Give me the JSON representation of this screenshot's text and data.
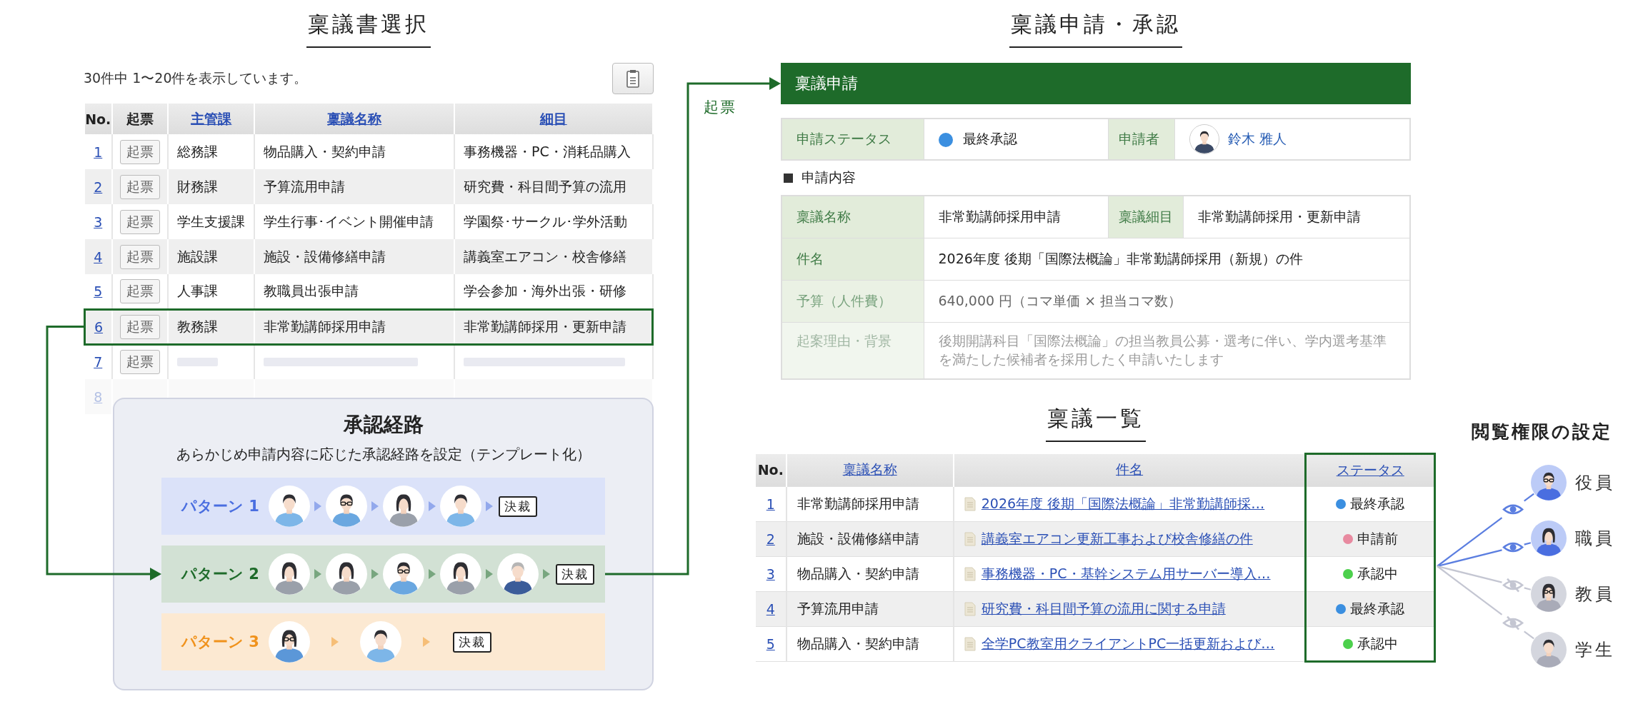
{
  "selection": {
    "title": "稟議書選択",
    "count_text": "30件中 1〜20件を表示しています。",
    "columns": [
      {
        "label": "No.",
        "kind": "plain"
      },
      {
        "label": "起票",
        "kind": "plain"
      },
      {
        "label": "主管課",
        "kind": "link"
      },
      {
        "label": "稟議名称",
        "kind": "link"
      },
      {
        "label": "細目",
        "kind": "link"
      }
    ],
    "rows": [
      {
        "kind": "data",
        "no": "1",
        "button": "起票",
        "dept": "総務課",
        "name": "物品購入・契約申請",
        "detail": "事務機器・PC・消耗品購入",
        "selected": false
      },
      {
        "kind": "data",
        "no": "2",
        "button": "起票",
        "dept": "財務課",
        "name": "予算流用申請",
        "detail": "研究費・科目間予算の流用",
        "selected": false
      },
      {
        "kind": "data",
        "no": "3",
        "button": "起票",
        "dept": "学生支援課",
        "name": "学生行事･イベント開催申請",
        "detail": "学園祭･サークル･学外活動",
        "selected": false
      },
      {
        "kind": "data",
        "no": "4",
        "button": "起票",
        "dept": "施設課",
        "name": "施設・設備修繕申請",
        "detail": "講義室エアコン・校舎修繕",
        "selected": false
      },
      {
        "kind": "data",
        "no": "5",
        "button": "起票",
        "dept": "人事課",
        "name": "教職員出張申請",
        "detail": "学会参加・海外出張・研修",
        "selected": false
      },
      {
        "kind": "data",
        "no": "6",
        "button": "起票",
        "dept": "教務課",
        "name": "非常勤講師採用申請",
        "detail": "非常勤講師採用・更新申請",
        "selected": true
      },
      {
        "kind": "skeleton",
        "no": "7",
        "button": "起票",
        "selected": false
      },
      {
        "kind": "faded",
        "no": "8",
        "selected": false
      }
    ]
  },
  "route": {
    "title": "承認経路",
    "subtitle": "あらかじめ申請内容に応じた承認経路を設定（テンプレート化）",
    "patterns": [
      {
        "label": "パターン 1",
        "color": "#4a6ee0",
        "approvers": [
          {
            "kind": "man"
          },
          {
            "kind": "man-glasses"
          },
          {
            "kind": "woman"
          },
          {
            "kind": "man"
          }
        ],
        "final": "決裁"
      },
      {
        "label": "パターン 2",
        "color": "#1e6b2a",
        "approvers": [
          {
            "kind": "woman"
          },
          {
            "kind": "woman"
          },
          {
            "kind": "man-glasses"
          },
          {
            "kind": "woman"
          },
          {
            "kind": "senior"
          }
        ],
        "final": "決裁"
      },
      {
        "label": "パターン 3",
        "color": "#f0921c",
        "approvers": [
          {
            "kind": "woman-glasses"
          },
          {
            "kind": "man"
          }
        ],
        "final": "決裁"
      }
    ]
  },
  "connector_label": "起票",
  "application": {
    "title": "稟議申請・承認",
    "header": "稟議申請",
    "status_label": "申請ステータス",
    "status": {
      "text": "最終承認",
      "color": "#3b8fe0"
    },
    "applicant_label": "申請者",
    "applicant": "鈴木 雅人",
    "section": "申請内容",
    "rows": [
      {
        "cells": [
          {
            "label": "稟議名称",
            "value": "非常勤講師採用申請"
          },
          {
            "label": "稟議細目",
            "value": "非常勤講師採用・更新申請"
          }
        ]
      },
      {
        "cells": [
          {
            "label": "件名",
            "value": "2026年度 後期「国際法概論」非常勤講師採用（新規）の件"
          }
        ]
      },
      {
        "cells": [
          {
            "label": "予算（人件費）",
            "value": "640,000 円（コマ単価 × 担当コマ数）"
          }
        ]
      },
      {
        "cells": [
          {
            "label": "起案理由・背景",
            "value": "後期開講科目「国際法概論」の担当教員公募・選考に伴い、学内選考基準を満たした候補者を採用したく申請いたします"
          }
        ]
      }
    ]
  },
  "list": {
    "title": "稟議一覧",
    "columns": [
      {
        "label": "No.",
        "kind": "plain",
        "highlighted": false
      },
      {
        "label": "稟議名称",
        "kind": "link",
        "highlighted": false
      },
      {
        "label": "件名",
        "kind": "link",
        "highlighted": false
      },
      {
        "label": "ステータス",
        "kind": "link",
        "highlighted": true
      }
    ],
    "rows": [
      {
        "no": "1",
        "name": "非常勤講師採用申請",
        "subject": "2026年度 後期「国際法概論」非常勤講師採…",
        "status": "最終承認",
        "color": "#3b8fe0"
      },
      {
        "no": "2",
        "name": "施設・設備修繕申請",
        "subject": "講義室エアコン更新工事および校舎修繕の件",
        "status": "申請前",
        "color": "#e88aa0"
      },
      {
        "no": "3",
        "name": "物品購入・契約申請",
        "subject": "事務機器・PC・基幹システム用サーバー導入…",
        "status": "承認中",
        "color": "#4cd04c"
      },
      {
        "no": "4",
        "name": "予算流用申請",
        "subject": "研究費・科目間予算の流用に関する申請",
        "status": "最終承認",
        "color": "#3b8fe0"
      },
      {
        "no": "5",
        "name": "物品購入・契約申請",
        "subject": "全学PC教室用クライアントPC一括更新および…",
        "status": "承認中",
        "color": "#4cd04c"
      }
    ]
  },
  "access": {
    "title": "閲覧権限の設定",
    "roles": [
      {
        "label": "役員",
        "visible": true,
        "kind": "man-glasses"
      },
      {
        "label": "職員",
        "visible": true,
        "kind": "woman"
      },
      {
        "label": "教員",
        "visible": false,
        "kind": "woman-glasses"
      },
      {
        "label": "学生",
        "visible": false,
        "kind": "man"
      }
    ]
  }
}
